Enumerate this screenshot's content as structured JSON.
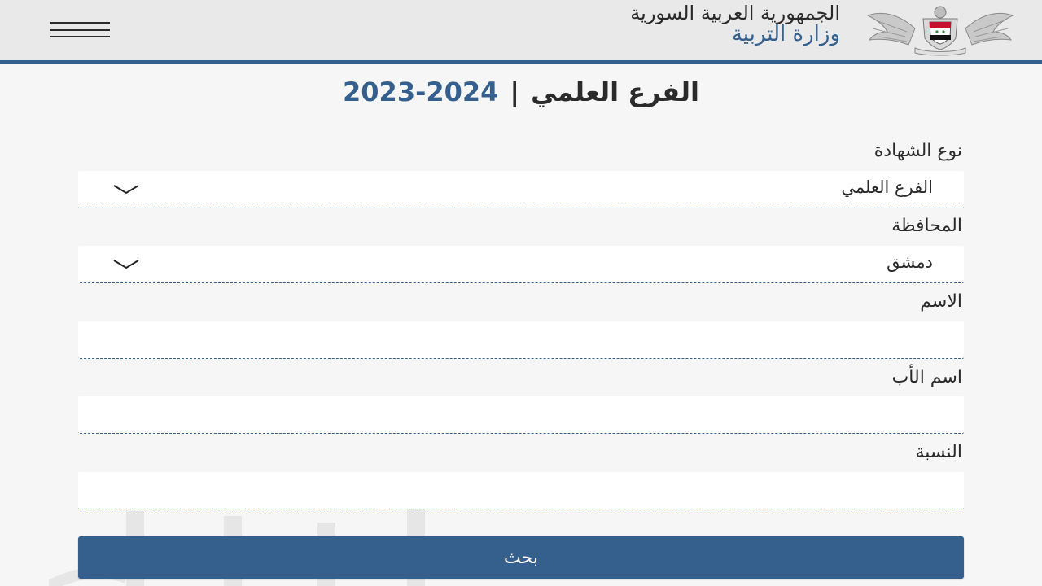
{
  "header": {
    "country": "الجمهورية العربية السورية",
    "ministry": "وزارة التربية",
    "emblem_icon": "syrian-eagle-emblem",
    "menu_icon": "hamburger-menu-icon"
  },
  "title": {
    "branch": "الفرع العلمي",
    "separator": "|",
    "year": "2024-2023"
  },
  "form": {
    "certificate_type": {
      "label": "نوع الشهادة",
      "value": "الفرع العلمي"
    },
    "governorate": {
      "label": "المحافظة",
      "value": "دمشق"
    },
    "name": {
      "label": "الاسم",
      "value": ""
    },
    "father_name": {
      "label": "اسم الأب",
      "value": ""
    },
    "percentage": {
      "label": "النسبة",
      "value": ""
    },
    "search_label": "بحث"
  },
  "colors": {
    "primary": "#355f8d",
    "header_bg": "#e9e9e9",
    "page_bg": "#f6f6f6"
  }
}
